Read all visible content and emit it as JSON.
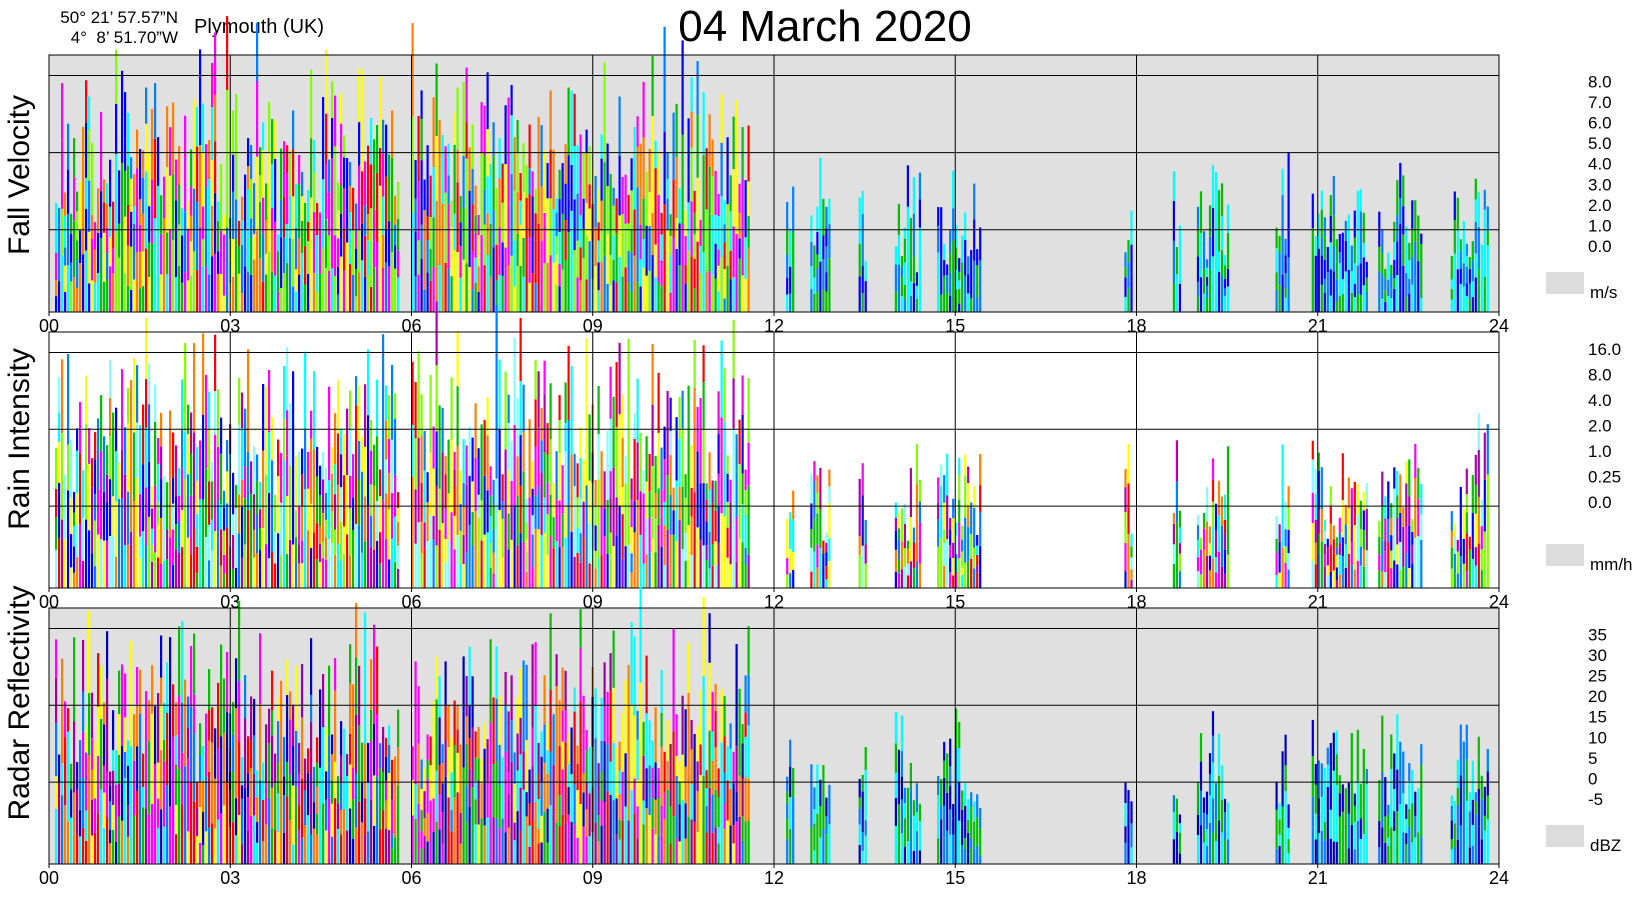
{
  "header": {
    "lat": "50° 21’ 57.57”N",
    "lon": "4°  8’ 51.70”W",
    "location": "Plymouth (UK)",
    "title": "04 March  2020"
  },
  "chart_data": {
    "type": "heatmap",
    "x_ticks": [
      "00",
      "03",
      "06",
      "09",
      "12",
      "15",
      "18",
      "21",
      "24"
    ],
    "xlim_hours": [
      0,
      24
    ],
    "grid": true,
    "panels": [
      {
        "name": "fall-velocity",
        "ylabel": "Fall Velocity",
        "unit": "m/s",
        "colorbar": [
          {
            "label": "8.0",
            "color": "#ff00ff"
          },
          {
            "label": "7.0",
            "color": "#ff0000"
          },
          {
            "label": "6.0",
            "color": "#ff8000"
          },
          {
            "label": "5.0",
            "color": "#ffff00"
          },
          {
            "label": "4.0",
            "color": "#80ff00"
          },
          {
            "label": "3.0",
            "color": "#00c000"
          },
          {
            "label": "2.0",
            "color": "#00ffff"
          },
          {
            "label": "1.0",
            "color": "#0080ff"
          },
          {
            "label": "0.0",
            "color": "#0000ff"
          }
        ],
        "nodata_color": "#dcdcdc",
        "background": "#e0e0e0"
      },
      {
        "name": "rain-intensity",
        "ylabel": "Rain Intensity",
        "unit": "mm/h",
        "colorbar": [
          {
            "label": "16.0",
            "color": "#b000b0"
          },
          {
            "label": "8.0",
            "color": "#ff00ff"
          },
          {
            "label": "4.0",
            "color": "#ff0000"
          },
          {
            "label": "2.0",
            "color": "#ff8000"
          },
          {
            "label": "1.0",
            "color": "#ffff00"
          },
          {
            "label": "0.25",
            "color": "#80ff00"
          },
          {
            "label": "0.0",
            "color": "#00c000"
          },
          {
            "label": "",
            "color": "#0000ff"
          },
          {
            "label": "",
            "color": "#0080ff"
          },
          {
            "label": "",
            "color": "#00ffff"
          },
          {
            "label": "",
            "color": "#80ffff"
          }
        ],
        "colorbar_labels": [
          "16.0",
          "8.0",
          "4.0",
          "2.0",
          "1.0",
          "0.25",
          "0.0"
        ],
        "nodata_color": "#dcdcdc",
        "background": "#ffffff"
      },
      {
        "name": "radar-reflectivity",
        "ylabel": "Radar Reflectivity",
        "unit": "dBZ",
        "colorbar": [
          {
            "label": "35",
            "color": "#ff00ff"
          },
          {
            "label": "30",
            "color": "#a000a0"
          },
          {
            "label": "25",
            "color": "#ff0000"
          },
          {
            "label": "20",
            "color": "#ff8000"
          },
          {
            "label": "15",
            "color": "#ffff00"
          },
          {
            "label": "10",
            "color": "#00c000"
          },
          {
            "label": "5",
            "color": "#00ffff"
          },
          {
            "label": "0",
            "color": "#0080ff"
          },
          {
            "label": "-5",
            "color": "#0000c0"
          }
        ],
        "nodata_color": "#dcdcdc",
        "background": "#e0e0e0"
      }
    ],
    "activity_intervals_hours": [
      [
        0.1,
        5.8
      ],
      [
        6.0,
        11.6
      ],
      [
        12.2,
        12.3
      ],
      [
        12.6,
        12.9
      ],
      [
        13.4,
        13.5
      ],
      [
        14.0,
        14.4
      ],
      [
        14.7,
        15.4
      ],
      [
        17.8,
        17.9
      ],
      [
        18.6,
        18.7
      ],
      [
        19.0,
        19.5
      ],
      [
        20.3,
        20.5
      ],
      [
        20.9,
        21.8
      ],
      [
        22.0,
        22.7
      ],
      [
        23.2,
        23.8
      ]
    ]
  }
}
